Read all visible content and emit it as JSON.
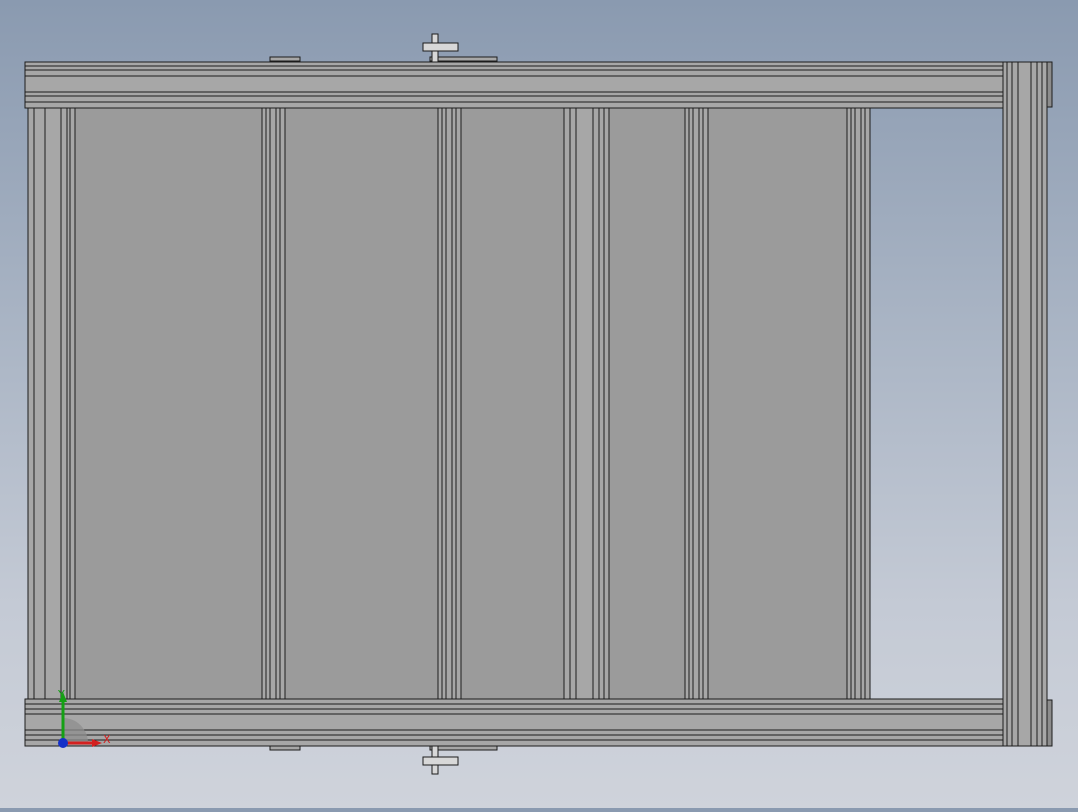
{
  "viewport": {
    "background_top": "#8a9ab0",
    "background_bottom": "#cfd3db"
  },
  "model": {
    "panel_fill": "#9b9b9b",
    "frame_fill": "#a7a7a7",
    "frame_shadow": "#8c8c8c",
    "edge_color": "#1c1c1c"
  },
  "triad": {
    "x_label": "X",
    "y_label": "Y",
    "x_color": "#d42020",
    "y_color": "#14a014",
    "z_color": "#1430c8"
  }
}
